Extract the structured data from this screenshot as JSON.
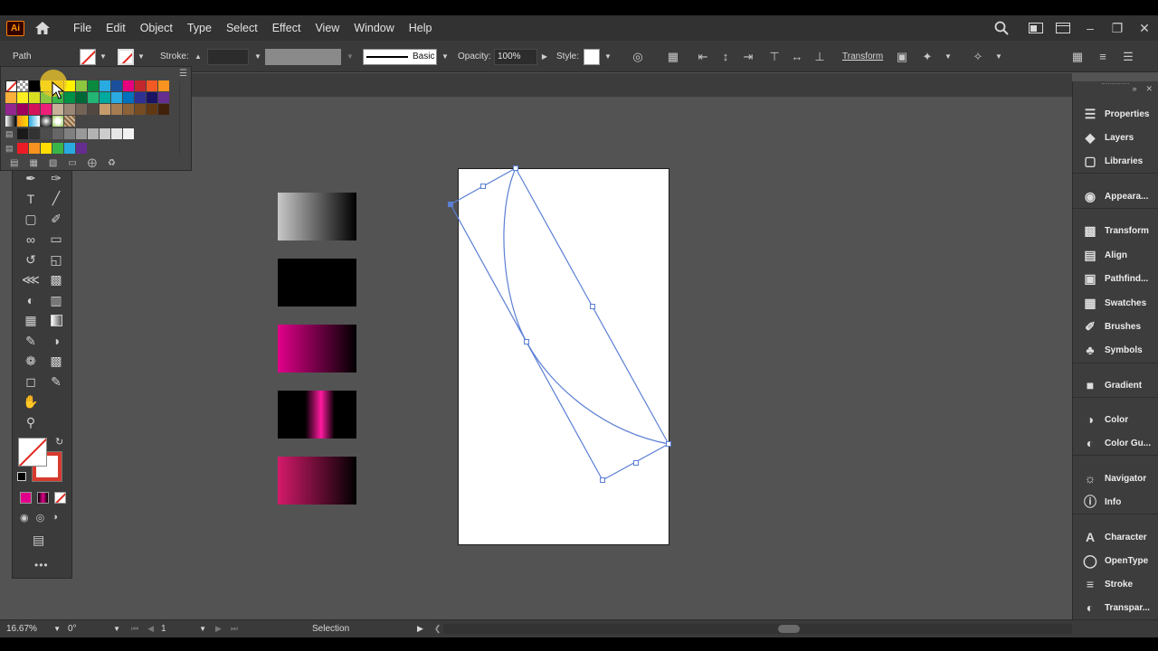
{
  "menubar": {
    "logo": "Ai",
    "items": [
      "File",
      "Edit",
      "Object",
      "Type",
      "Select",
      "Effect",
      "View",
      "Window",
      "Help"
    ]
  },
  "control": {
    "selection_type": "Path",
    "stroke_label": "Stroke:",
    "brush_style": "Basic",
    "opacity_label": "Opacity:",
    "opacity_value": "100%",
    "style_label": "Style:",
    "transform_label": "Transform"
  },
  "swatches": {
    "rows": [
      [
        "#ffffff",
        "#f2f2f2",
        "#000000",
        "#fff000",
        "#ffc80a",
        "#fff200",
        "#8cc63f",
        "#0a8a3e",
        "#29abe2",
        "#1b4f9c",
        "#e6007e",
        "#c1272d",
        "#f15a24",
        "#f7931e"
      ],
      [
        "#fbb03b",
        "#fcee21",
        "#d9e021",
        "#8cc63f",
        "#39b54a",
        "#009245",
        "#006837",
        "#22b573",
        "#00a99d",
        "#29abe2",
        "#0071bc",
        "#2e3192",
        "#1b1464",
        "#662d91"
      ],
      [
        "#93278f",
        "#9e005d",
        "#d4145a",
        "#ed1e79",
        "#c7b299",
        "#998675",
        "#736357",
        "#534741",
        "#c69c6d",
        "#a67c52",
        "#8c6239",
        "#754c24",
        "#603813",
        "#42210b"
      ],
      [
        "#ffffff",
        "#f7931e",
        "#29abe2",
        "#ffffff",
        "#8cc63f",
        "#c7b299"
      ],
      [
        "#1a1a1a",
        "#333333",
        "#4d4d4d",
        "#666666",
        "#808080",
        "#999999",
        "#b3b3b3",
        "#cccccc",
        "#e6e6e6",
        "#f2f2f2"
      ],
      [
        "#ed1c24",
        "#f7931e",
        "#ffdd00",
        "#39b54a",
        "#29abe2",
        "#662d91"
      ]
    ]
  },
  "tools": {
    "items": [
      "selection-tool",
      "direct-selection-tool",
      "magic-wand-tool",
      "lasso-tool",
      "pen-tool",
      "curvature-tool",
      "type-tool",
      "line-tool",
      "rectangle-tool",
      "paintbrush-tool",
      "shaper-tool",
      "eraser-tool",
      "rotate-tool",
      "scale-tool",
      "width-tool",
      "free-transform-tool",
      "shape-builder-tool",
      "perspective-grid-tool",
      "mesh-tool",
      "gradient-tool",
      "eyedropper-tool",
      "blend-tool",
      "symbol-sprayer-tool",
      "column-graph-tool",
      "artboard-tool",
      "slice-tool",
      "hand-tool",
      "zoom-tool"
    ],
    "more": "•••"
  },
  "gradients": [
    {
      "name": "gray-to-black",
      "from": "#c8c8c8",
      "to": "#000000"
    },
    {
      "name": "black",
      "from": "#000000",
      "to": "#000000"
    },
    {
      "name": "magenta-to-black",
      "from": "#e2008a",
      "to": "#000000"
    },
    {
      "name": "black-magenta-black",
      "from": "#000000",
      "mid": "#ff1aa0",
      "to": "#000000"
    },
    {
      "name": "pink-to-black",
      "from": "#d41a6b",
      "to": "#000000"
    }
  ],
  "dock": {
    "items": [
      {
        "label": "Properties",
        "icon": "properties-icon"
      },
      {
        "label": "Layers",
        "icon": "layers-icon"
      },
      {
        "label": "Libraries",
        "icon": "libraries-icon"
      },
      {
        "label": "Appeara...",
        "icon": "appearance-icon"
      },
      {
        "label": "Transform",
        "icon": "transform-icon"
      },
      {
        "label": "Align",
        "icon": "align-icon"
      },
      {
        "label": "Pathfind...",
        "icon": "pathfinder-icon"
      },
      {
        "label": "Swatches",
        "icon": "swatches-icon"
      },
      {
        "label": "Brushes",
        "icon": "brushes-icon"
      },
      {
        "label": "Symbols",
        "icon": "symbols-icon"
      },
      {
        "label": "Gradient",
        "icon": "gradient-icon"
      },
      {
        "label": "Color",
        "icon": "color-icon"
      },
      {
        "label": "Color Gu...",
        "icon": "color-guide-icon"
      },
      {
        "label": "Navigator",
        "icon": "navigator-icon"
      },
      {
        "label": "Info",
        "icon": "info-icon"
      },
      {
        "label": "Character",
        "icon": "character-icon"
      },
      {
        "label": "OpenType",
        "icon": "opentype-icon"
      },
      {
        "label": "Stroke",
        "icon": "stroke-icon"
      },
      {
        "label": "Transpar...",
        "icon": "transparency-icon"
      }
    ]
  },
  "status": {
    "zoom": "16.67%",
    "rotation": "0°",
    "artboard_number": "1",
    "current_tool": "Selection"
  },
  "colors": {
    "path_selection": "#5b7fd4",
    "fill_none_slash": "#e0281f"
  }
}
